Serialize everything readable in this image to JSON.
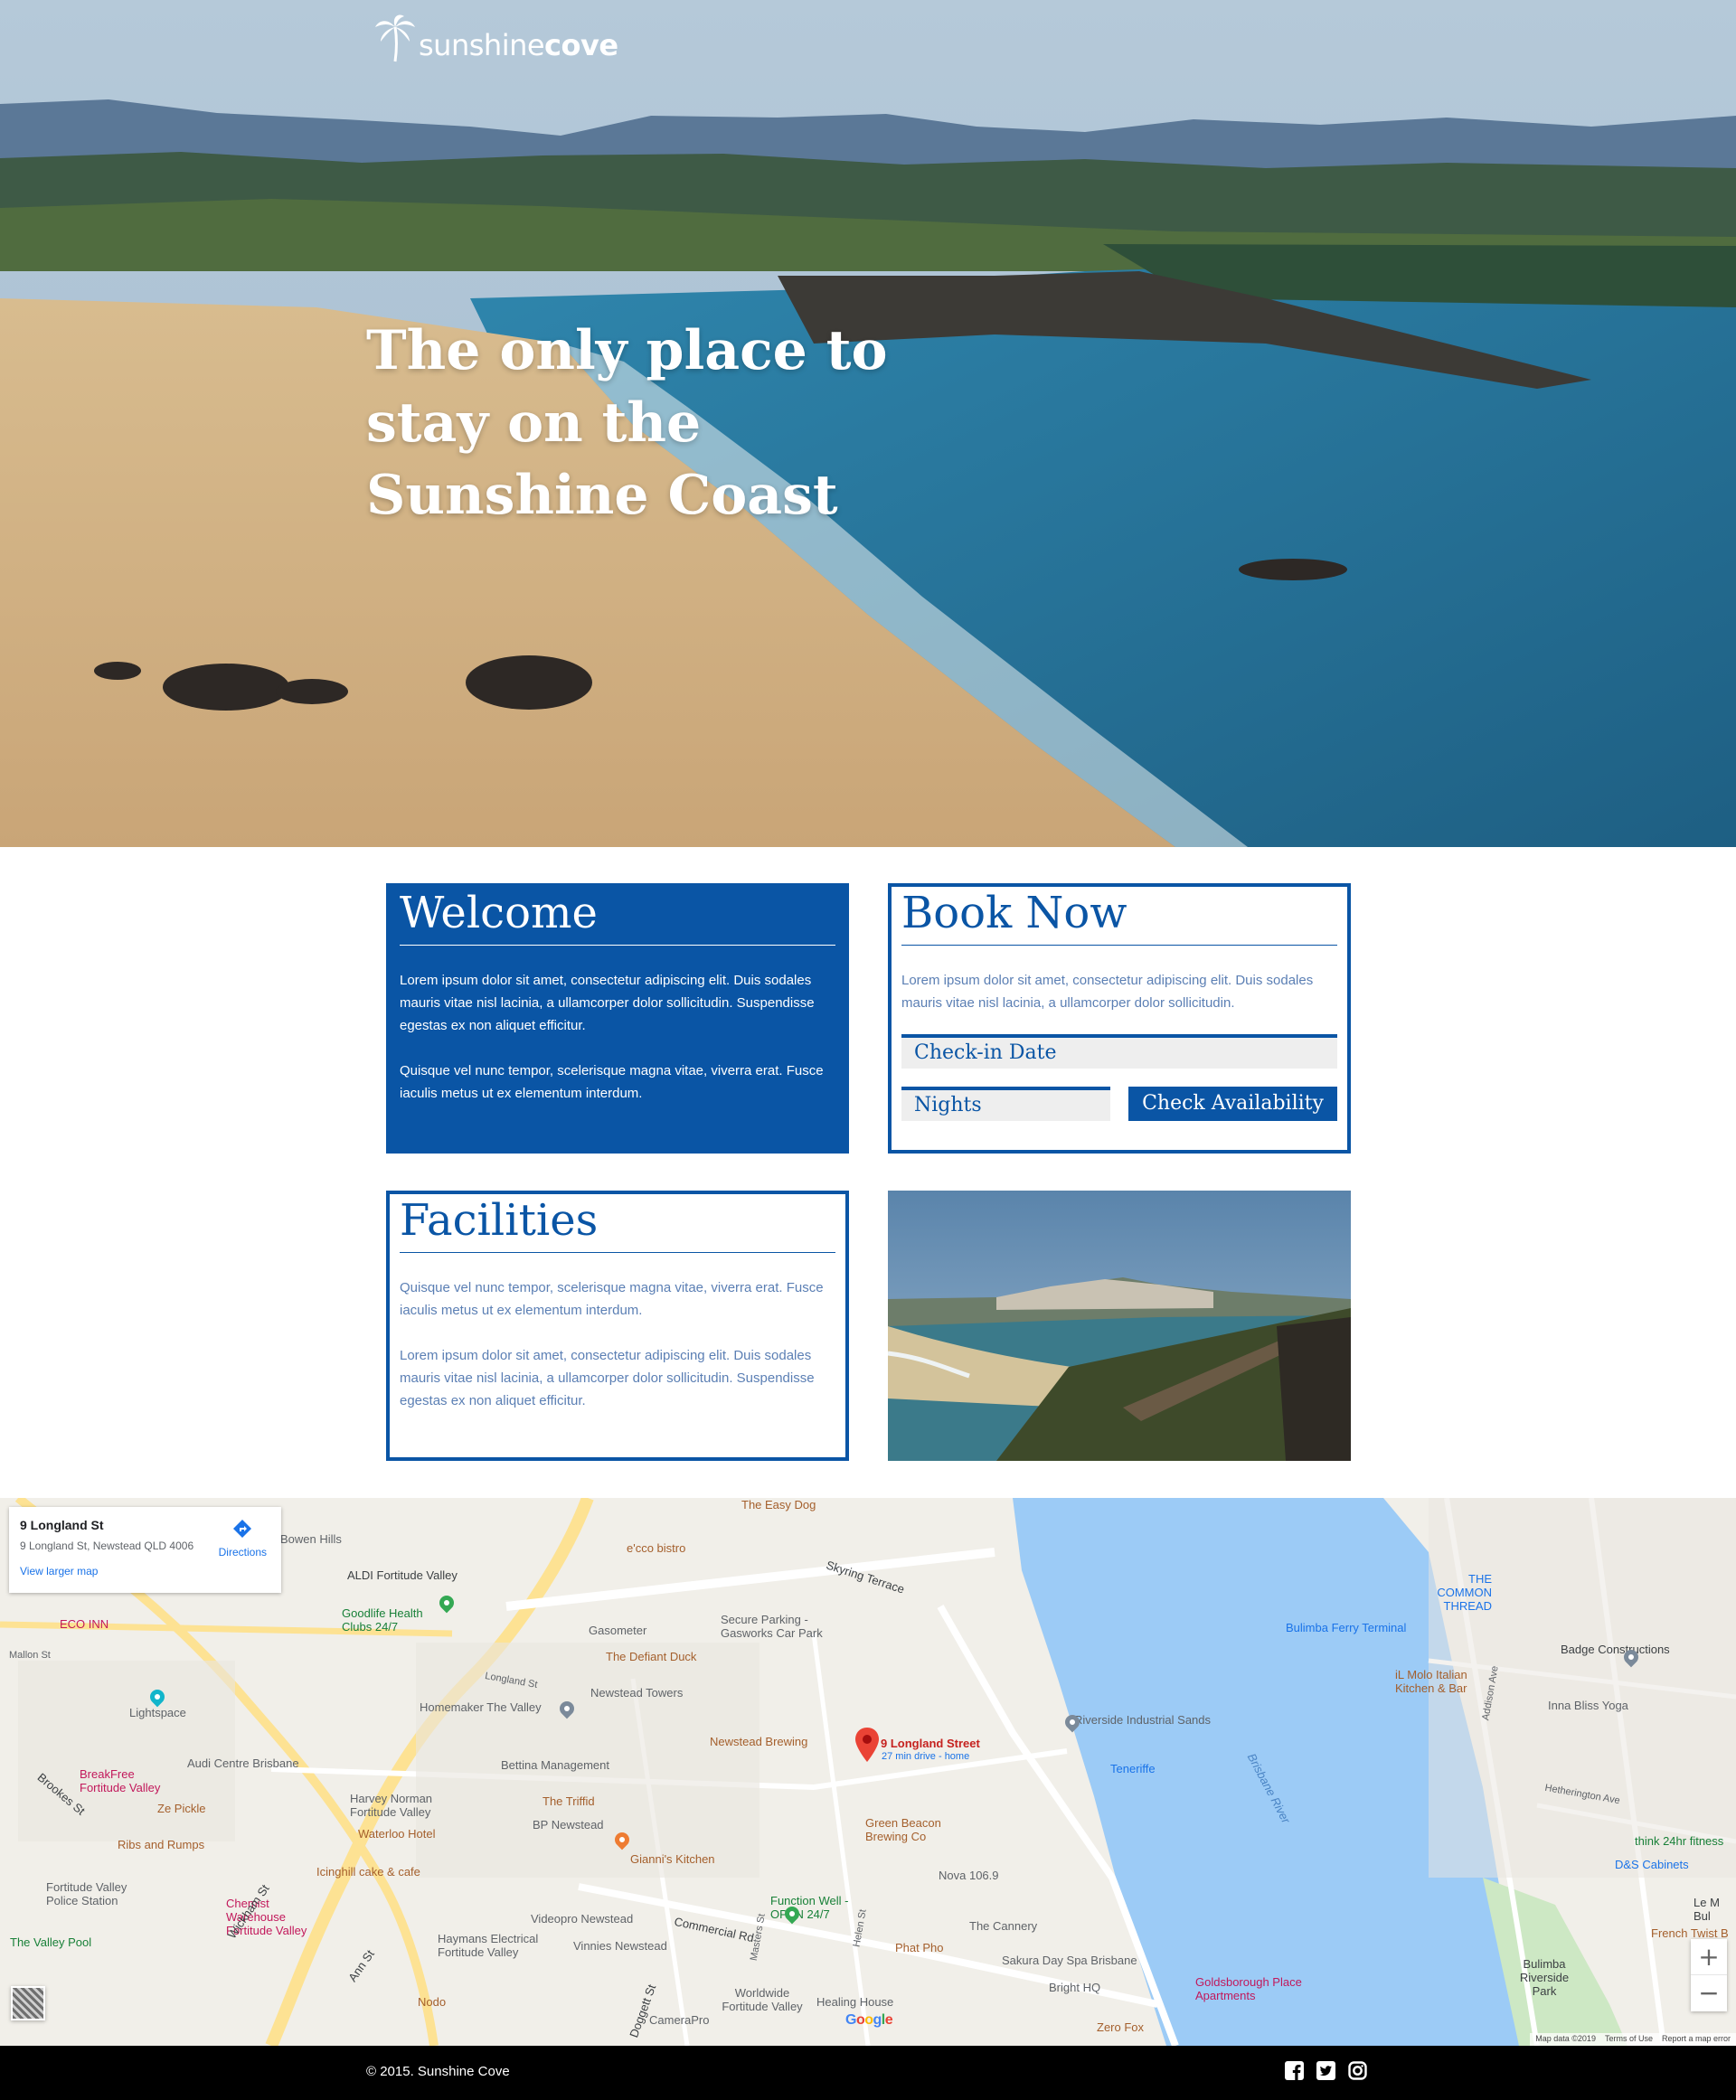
{
  "brand": {
    "logo_light": "sunshine",
    "logo_bold": "cove"
  },
  "hero": {
    "title": "The only place to stay on the Sunshine Coast"
  },
  "welcome": {
    "heading": "Welcome",
    "para1": "Lorem ipsum dolor sit amet, consectetur adipiscing elit. Duis sodales mauris vitae nisl lacinia, a ullamcorper dolor sollicitudin. Suspendisse egestas ex non aliquet efficitur.",
    "para2": "Quisque vel nunc tempor, scelerisque magna vitae, viverra erat. Fusce iaculis metus ut ex elementum interdum."
  },
  "book": {
    "heading": "Book Now",
    "text": "Lorem ipsum dolor sit amet, consectetur adipiscing elit. Duis sodales mauris vitae nisl lacinia, a ullamcorper dolor sollicitudin.",
    "checkin_placeholder": "Check-in Date",
    "nights_placeholder": "Nights",
    "button": "Check Availability"
  },
  "facilities": {
    "heading": "Facilities",
    "para1": "Quisque vel nunc tempor, scelerisque magna vitae, viverra erat. Fusce iaculis metus ut ex elementum interdum.",
    "para2": "Lorem ipsum dolor sit amet, consectetur adipiscing elit. Duis sodales mauris vitae nisl lacinia, a ullamcorper dolor sollicitudin. Suspendisse egestas ex non aliquet efficitur."
  },
  "map": {
    "info_title": "9 Longland St",
    "info_address": "9 Longland St, Newstead QLD 4006",
    "directions": "Directions",
    "larger_map": "View larger map",
    "marker_title": "9 Longland Street",
    "marker_sub": "27 min drive - home",
    "zoom_in": "+",
    "zoom_out": "−",
    "footer": [
      "Map data ©2019",
      "Terms of Use",
      "Report a map error"
    ],
    "places": {
      "bowen_hills": "Bowen Hills",
      "aldi": "ALDI Fortitude Valley",
      "goodlife": "Goodlife Health Clubs 24/7",
      "eco_inn": "ECO INN",
      "lightspace": "Lightspace",
      "homemaker": "Homemaker The Valley",
      "newstead_towers": "Newstead Towers",
      "gasometer": "Gasometer",
      "defiant_duck": "The Defiant Duck",
      "secure_parking": "Secure Parking - Gasworks Car Park",
      "ecco": "e'cco bistro",
      "newstead_brewing": "Newstead Brewing",
      "bettina": "Bettina Management",
      "audi": "Audi Centre Brisbane",
      "breakfree": "BreakFree Fortitude Valley",
      "ze_pickle": "Ze Pickle",
      "ribs": "Ribs and Rumps",
      "harvey": "Harvey Norman Fortitude Valley",
      "waterloo": "Waterloo Hotel",
      "triffid": "The Triffid",
      "bp": "BP Newstead",
      "icinghill": "Icinghill cake & cafe",
      "giannis": "Gianni's Kitchen",
      "green_beacon": "Green Beacon Brewing Co",
      "nova": "Nova 106.9",
      "police": "Fortitude Valley Police Station",
      "chemist": "Chemist Warehouse Fortitude Valley",
      "videopro": "Videopro Newstead",
      "function_well": "Function Well - OPEN 24/7",
      "cannery": "The Cannery",
      "valley_pool": "The Valley Pool",
      "haymans": "Haymans Electrical Fortitude Valley",
      "vinnies": "Vinnies Newstead",
      "phat_pho": "Phat Pho",
      "sakura": "Sakura Day Spa Brisbane",
      "bright_hq": "Bright HQ",
      "nodo": "Nodo",
      "camerapro": "CameraPro",
      "worldwide": "Worldwide Fortitude Valley",
      "healing": "Healing House",
      "riverside": "Riverside Industrial Sands",
      "teneriffe": "Teneriffe",
      "brisbane_river": "Brisbane River",
      "bulimba_ferry": "Bulimba Ferry Terminal",
      "common_thread": "THE COMMON THREAD",
      "badge": "Badge Constructions",
      "il_molo": "iL Molo Italian Kitchen & Bar",
      "inna_bliss": "Inna Bliss Yoga",
      "goldsborough": "Goldsborough Place Apartments",
      "zero_fox": "Zero Fox",
      "think24": "think 24hr fitness",
      "dns": "D&S Cabinets",
      "french_twist": "French Twist B",
      "le_m": "Le M Bul",
      "bulimba_riverside": "Bulimba Riverside Park",
      "skyring": "Skyring Terrace",
      "easy_dog": "The Easy Dog",
      "commercial_rd": "Commercial Rd",
      "wickham_st": "Wickham St",
      "ann_st": "Ann St",
      "brookes_st": "Brookes St",
      "doggett_st": "Doggett St",
      "longland_st": "Longland St",
      "mallon_st": "Mallon St",
      "masters_st": "Masters St",
      "helen_st": "Helen St",
      "hetherington": "Hetherington Ave",
      "addison_ave": "Addison Ave"
    }
  },
  "footer": {
    "copyright": "© 2015. Sunshine Cove"
  },
  "colors": {
    "brand_blue": "#0a55a5",
    "sand": "#d9b98a",
    "ocean": "#2d7aa6",
    "river": "#9ccbf6"
  },
  "icons": [
    "palm-logo-icon",
    "directions-icon",
    "map-marker-icon",
    "facebook-icon",
    "twitter-icon",
    "instagram-icon"
  ]
}
